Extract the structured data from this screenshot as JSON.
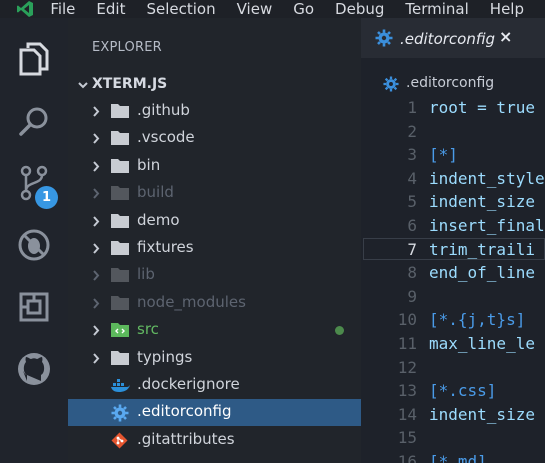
{
  "menu": {
    "items": [
      "File",
      "Edit",
      "Selection",
      "View",
      "Go",
      "Debug",
      "Terminal",
      "Help"
    ]
  },
  "activity_bar": {
    "items": [
      {
        "name": "explorer-icon"
      },
      {
        "name": "search-icon"
      },
      {
        "name": "source-control-icon"
      },
      {
        "name": "debug-icon"
      },
      {
        "name": "extensions-icon"
      },
      {
        "name": "github-icon"
      }
    ],
    "scm_badge": "1",
    "accent": "#3797e3"
  },
  "explorer": {
    "title": "EXPLORER",
    "folder": "XTERM.JS",
    "entries": [
      {
        "label": ".github",
        "kind": "folder",
        "state": "normal"
      },
      {
        "label": ".vscode",
        "kind": "folder",
        "state": "normal"
      },
      {
        "label": "bin",
        "kind": "folder",
        "state": "normal"
      },
      {
        "label": "build",
        "kind": "folder",
        "state": "ignored"
      },
      {
        "label": "demo",
        "kind": "folder",
        "state": "normal"
      },
      {
        "label": "fixtures",
        "kind": "folder",
        "state": "normal"
      },
      {
        "label": "lib",
        "kind": "folder",
        "state": "ignored"
      },
      {
        "label": "node_modules",
        "kind": "folder",
        "state": "ignored"
      },
      {
        "label": "src",
        "kind": "src-folder",
        "state": "modified"
      },
      {
        "label": "typings",
        "kind": "folder",
        "state": "normal"
      },
      {
        "label": ".dockerignore",
        "kind": "docker",
        "state": "normal"
      },
      {
        "label": ".editorconfig",
        "kind": "gear",
        "state": "selected"
      },
      {
        "label": ".gitattributes",
        "kind": "git",
        "state": "normal"
      }
    ]
  },
  "editor": {
    "tab_label": ".editorconfig",
    "tab_close": "×",
    "breadcrumb": ".editorconfig",
    "active_line": "7",
    "lines": [
      {
        "n": "1",
        "text": "root = true"
      },
      {
        "n": "2",
        "text": ""
      },
      {
        "n": "3",
        "text": "[*]"
      },
      {
        "n": "4",
        "text": "indent_style"
      },
      {
        "n": "5",
        "text": "indent_size"
      },
      {
        "n": "6",
        "text": "insert_final"
      },
      {
        "n": "7",
        "text": "trim_traili"
      },
      {
        "n": "8",
        "text": "end_of_line"
      },
      {
        "n": "9",
        "text": ""
      },
      {
        "n": "10",
        "text": "[*.{j,t}s]"
      },
      {
        "n": "11",
        "text": "max_line_le"
      },
      {
        "n": "12",
        "text": ""
      },
      {
        "n": "13",
        "text": "[*.css]"
      },
      {
        "n": "14",
        "text": "indent_size"
      },
      {
        "n": "15",
        "text": ""
      },
      {
        "n": "16",
        "text": "[*.md]"
      }
    ]
  },
  "colors": {
    "selection": "#2e5a86",
    "modified_text": "#62b862",
    "ignored_text": "#5d6470"
  }
}
